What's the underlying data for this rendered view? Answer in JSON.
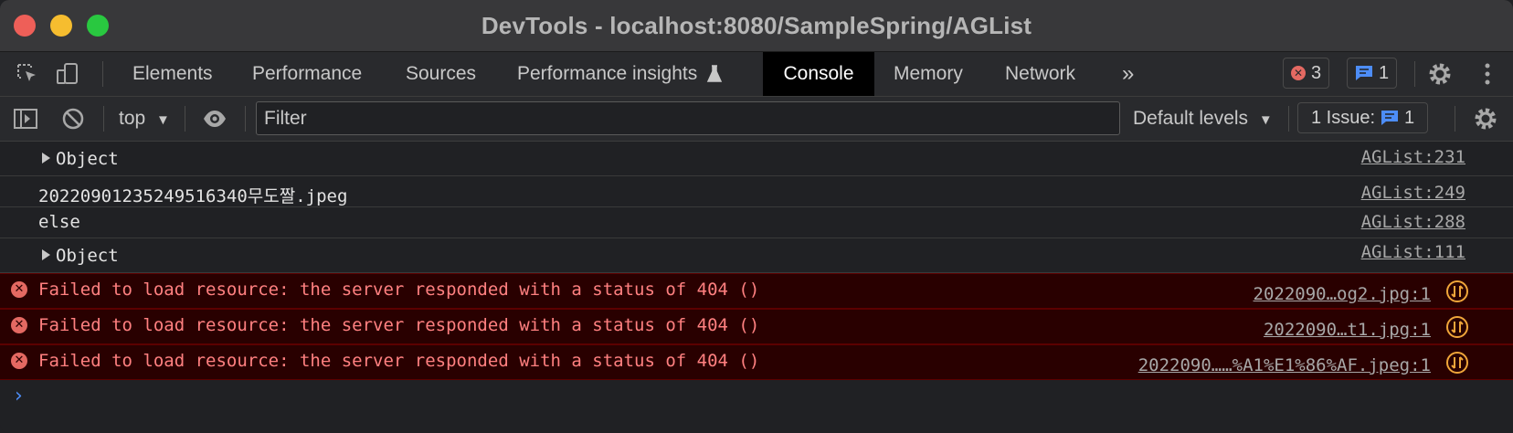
{
  "window": {
    "title": "DevTools - localhost:8080/SampleSpring/AGList"
  },
  "tabs": [
    {
      "label": "Elements"
    },
    {
      "label": "Performance"
    },
    {
      "label": "Sources"
    },
    {
      "label": "Performance insights",
      "icon": "flask-icon"
    },
    {
      "label": "Console",
      "active": true
    },
    {
      "label": "Memory"
    },
    {
      "label": "Network"
    }
  ],
  "badges": {
    "errors": "3",
    "messages": "1"
  },
  "console_toolbar": {
    "context": "top",
    "filter_placeholder": "Filter",
    "levels": "Default levels",
    "issues_label": "1 Issue:",
    "issues_count": "1"
  },
  "rows": [
    {
      "type": "log",
      "expandable": true,
      "text": "Object",
      "source": "AGList:231"
    },
    {
      "type": "log",
      "expandable": false,
      "text": "20220901235249516340무도짤.jpeg",
      "source": "AGList:249"
    },
    {
      "type": "log",
      "expandable": false,
      "text": "else",
      "source": "AGList:288"
    },
    {
      "type": "log",
      "expandable": true,
      "text": "Object",
      "source": "AGList:111"
    },
    {
      "type": "error",
      "text": "Failed to load resource: the server responded with a status of 404 ()",
      "source": "2022090…og2.jpg:1"
    },
    {
      "type": "error",
      "text": "Failed to load resource: the server responded with a status of 404 ()",
      "source": "2022090…t1.jpg:1"
    },
    {
      "type": "error",
      "text": "Failed to load resource: the server responded with a status of 404 ()",
      "source": "2022090……%A1%E1%86%AF.jpeg:1"
    }
  ],
  "colors": {
    "error_text": "#ff8080",
    "error_bg": "#290000",
    "accent_blue": "#4d8df7",
    "warning_orange": "#f0a63a"
  }
}
